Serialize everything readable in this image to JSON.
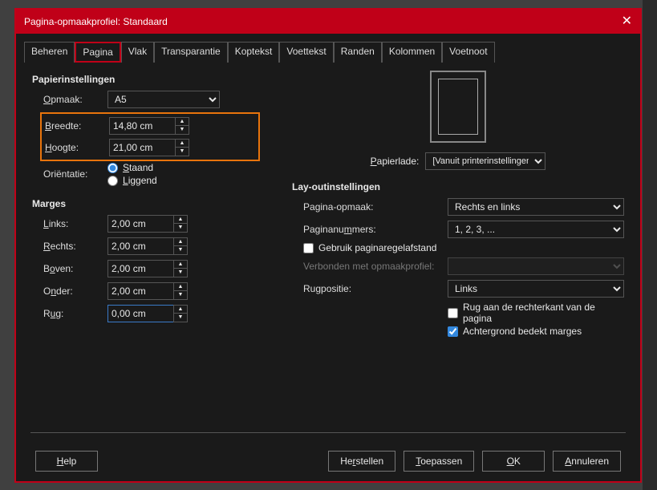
{
  "title": "Pagina-opmaakprofiel: Standaard",
  "tabs": [
    "Beheren",
    "Pagina",
    "Vlak",
    "Transparantie",
    "Koptekst",
    "Voettekst",
    "Randen",
    "Kolommen",
    "Voetnoot"
  ],
  "paper": {
    "section": "Papierinstellingen",
    "format_label": "Opmaak:",
    "format_value": "A5",
    "width_label": "Breedte:",
    "width_value": "14,80 cm",
    "height_label": "Hoogte:",
    "height_value": "21,00 cm",
    "orient_label": "Oriëntatie:",
    "portrait": "Staand",
    "landscape": "Liggend",
    "tray_label": "Papierlade:",
    "tray_value": "[Vanuit printerinstellingen]"
  },
  "margins": {
    "section": "Marges",
    "left_label": "Links:",
    "left_value": "2,00 cm",
    "right_label": "Rechts:",
    "right_value": "2,00 cm",
    "top_label": "Boven:",
    "top_value": "2,00 cm",
    "bottom_label": "Onder:",
    "bottom_value": "2,00 cm",
    "gutter_label": "Rug:",
    "gutter_value": "0,00 cm"
  },
  "layout": {
    "section": "Lay-outinstellingen",
    "pagelayout_label": "Pagina-opmaak:",
    "pagelayout_value": "Rechts en links",
    "pagenum_label": "Paginanummers:",
    "pagenum_value": "1, 2, 3, ...",
    "register_label": "Gebruik paginaregelafstand",
    "refstyle_label": "Verbonden met opmaakprofiel:",
    "gutterpos_label": "Rugpositie:",
    "gutterpos_value": "Links",
    "gutter_right_label": "Rug aan de rechterkant van de pagina",
    "bg_label": "Achtergrond bedekt marges"
  },
  "buttons": {
    "help": "Help",
    "reset": "Herstellen",
    "apply": "Toepassen",
    "ok": "OK",
    "cancel": "Annuleren"
  }
}
